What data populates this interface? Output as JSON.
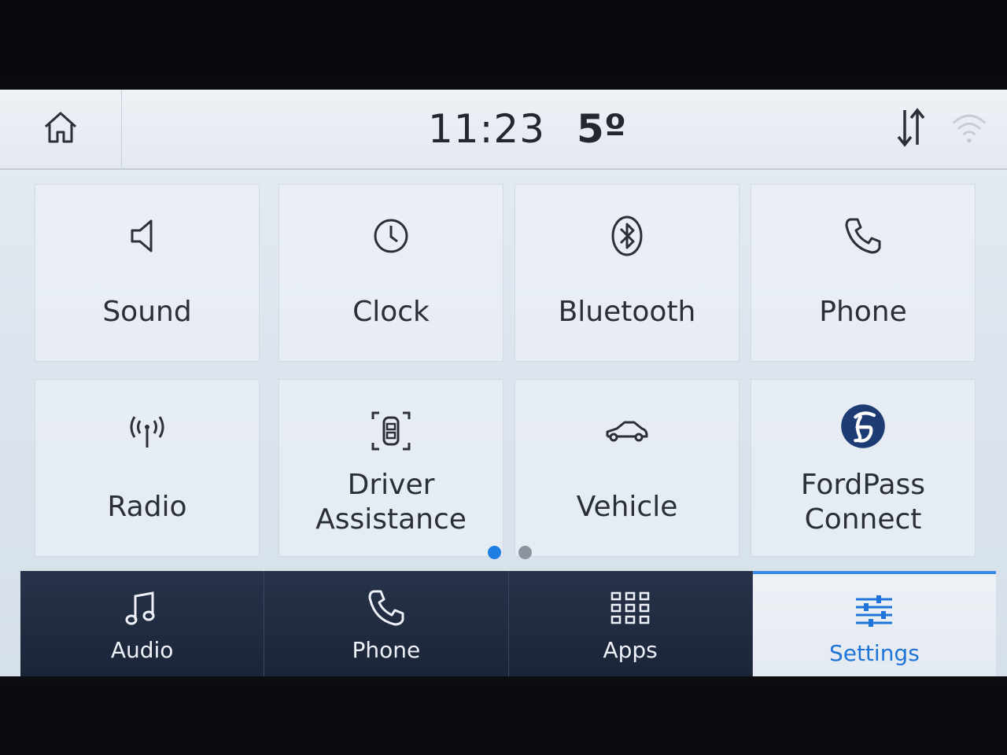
{
  "status_bar": {
    "time": "11:23",
    "temperature": "5º",
    "home_icon": "home-icon",
    "transfer_icon": "data-transfer-icon",
    "wifi_icon": "wifi-icon"
  },
  "tiles": [
    {
      "label": "Sound",
      "icon": "speaker-icon"
    },
    {
      "label": "Clock",
      "icon": "clock-icon"
    },
    {
      "label": "Bluetooth",
      "icon": "bluetooth-icon"
    },
    {
      "label": "Phone",
      "icon": "phone-icon"
    },
    {
      "label": "Radio",
      "icon": "radio-antenna-icon"
    },
    {
      "label_line1": "Driver",
      "label_line2": "Assistance",
      "icon": "driver-assistance-icon"
    },
    {
      "label": "Vehicle",
      "icon": "car-icon"
    },
    {
      "label_line1": "FordPass",
      "label_line2": "Connect",
      "icon": "fordpass-logo-icon"
    }
  ],
  "pagination": {
    "pages": 2,
    "current": 1
  },
  "bottom_nav": [
    {
      "label": "Audio",
      "icon": "music-note-icon",
      "active": false
    },
    {
      "label": "Phone",
      "icon": "phone-icon",
      "active": false
    },
    {
      "label": "Apps",
      "icon": "apps-grid-icon",
      "active": false
    },
    {
      "label": "Settings",
      "icon": "sliders-icon",
      "active": true
    }
  ],
  "colors": {
    "accent": "#1f74d8",
    "nav_bg": "#1b2538",
    "text": "#2a2f36"
  }
}
